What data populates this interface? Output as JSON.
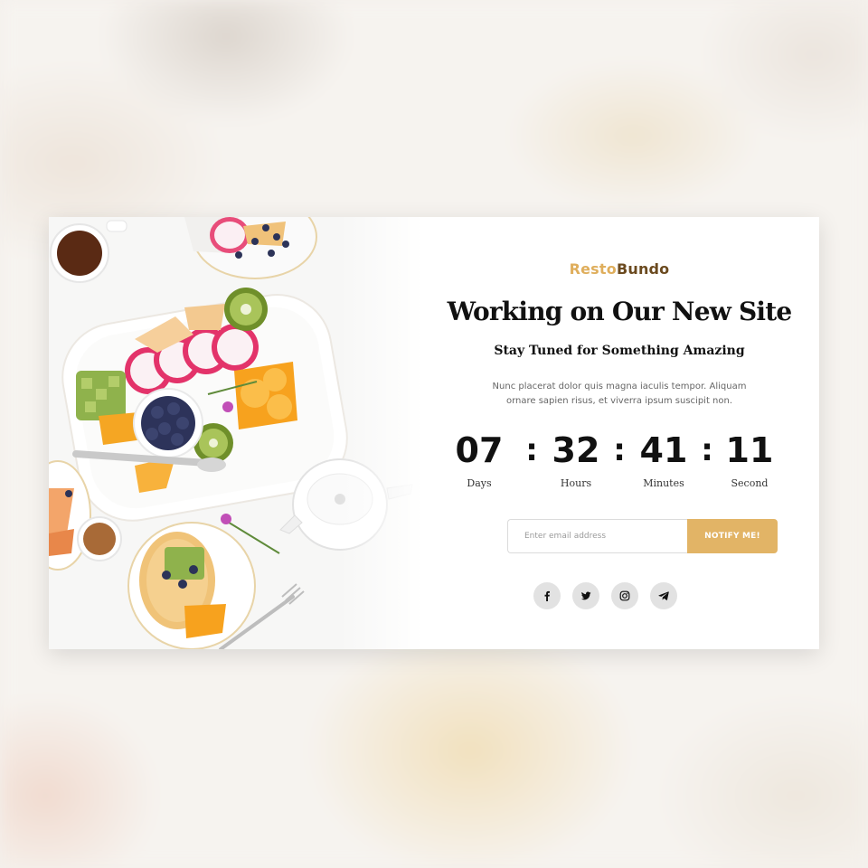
{
  "brand": {
    "part1": "Resto",
    "part2": "Bundo"
  },
  "headline": "Working on Our New Site",
  "subheadline": "Stay Tuned for Something Amazing",
  "description": "Nunc placerat dolor quis magna iaculis tempor. Aliquam ornare sapien risus, et viverra ipsum suscipit non.",
  "countdown": {
    "days": {
      "value": "07",
      "label": "Days"
    },
    "hours": {
      "value": "32",
      "label": "Hours"
    },
    "minutes": {
      "value": "41",
      "label": "Minutes"
    },
    "seconds": {
      "value": "11",
      "label": "Second"
    },
    "separator": ":"
  },
  "subscribe": {
    "placeholder": "Enter email address",
    "value": "",
    "button_label": "NOTIFY ME!"
  },
  "social": [
    "facebook-icon",
    "twitter-icon",
    "instagram-icon",
    "telegram-icon"
  ],
  "colors": {
    "brand_gold": "#dfae5c",
    "brand_brown": "#6b4a1f",
    "button_bg": "#e2b466",
    "social_bg": "#e2e2e2",
    "text_dark": "#111111"
  }
}
